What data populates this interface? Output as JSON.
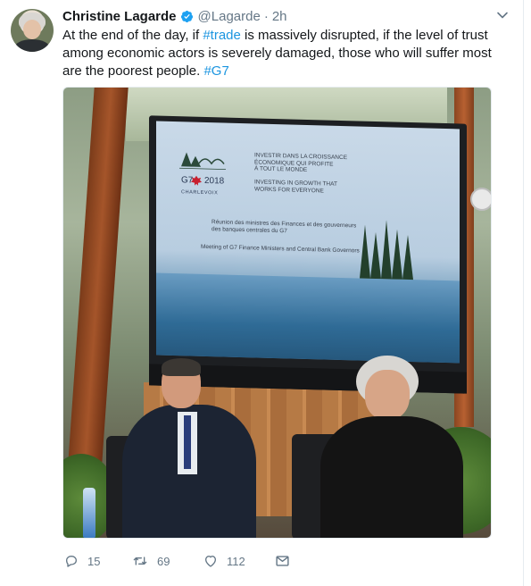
{
  "tweet": {
    "author_name": "Christine Lagarde",
    "handle": "@Lagarde",
    "separator": "·",
    "time": "2h",
    "text_parts": [
      "At the end of the day, if ",
      "#trade",
      " is massively disrupted, if the level of trust among economic actors is severely damaged, those who will suffer most are the poorest people. ",
      "#G7"
    ],
    "photo": {
      "screen_title_fr": "INVESTIR DANS LA CROISSANCE\nÉCONOMIQUE QUI PROFITE\nÀ TOUT LE MONDE",
      "screen_title_en": "INVESTING IN GROWTH THAT\nWORKS FOR EVERYONE",
      "screen_logo_text": "G7",
      "screen_logo_year": "2018",
      "screen_logo_place": "CHARLEVOIX",
      "screen_meeting_fr": "Réunion des ministres des Finances et des gouverneurs\ndes banques centrales du G7",
      "screen_meeting_en": "Meeting of G7 Finance Ministers and Central Bank Governors"
    },
    "actions": {
      "replies": "15",
      "retweets": "69",
      "likes": "112"
    }
  },
  "colors": {
    "link": "#1b95e0",
    "muted": "#657786",
    "verified": "#1da1f2"
  },
  "icons": {
    "verified": "verified-badge-icon",
    "caret": "chevron-down-icon",
    "reply": "reply-icon",
    "retweet": "retweet-icon",
    "like": "heart-icon",
    "dm": "envelope-icon"
  }
}
